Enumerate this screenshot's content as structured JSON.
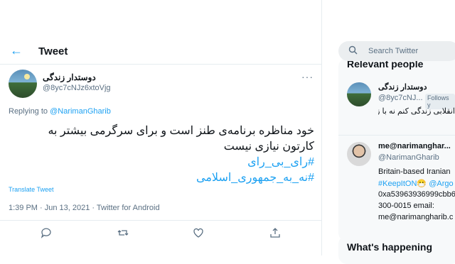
{
  "header": {
    "title": "Tweet"
  },
  "tweet": {
    "author_name": "دوستدار زندگی",
    "author_handle": "@8yc7cNJz6xtoVjg",
    "replying_prefix": "Replying to ",
    "replying_to": "@NarimanGharib",
    "text_line1": "خود مناظره برنامه‌ی طنز است و برای سرگرمی بیشتر به",
    "text_line2": "کارتون نیازی نیست",
    "hashtag1": "#رای_بی_رای",
    "hashtag2": "#نه_به_جمهوری_اسلامی",
    "translate": "Translate Tweet",
    "meta": "1:39 PM · Jun 13, 2021 · Twitter for Android"
  },
  "actions": [
    "reply-icon",
    "retweet-icon",
    "like-icon",
    "share-icon"
  ],
  "sidebar": {
    "search_placeholder": "Search Twitter",
    "relevant_title": "Relevant people",
    "people": [
      {
        "name": "دوستدار زندگی",
        "handle": "@8yc7cNJ...",
        "follows_badge": "Follows y",
        "bio": "انقلابی زندگی کنم نه با زور و"
      },
      {
        "name": "me@narimanghar...",
        "handle": "@NarimanGharib",
        "bio_line1": "Britain-based Iranian",
        "bio_line2_tag1": "#KeepItON",
        "bio_line2_emoji": "😷",
        "bio_line2_tag2": "@Argo",
        "bio_line3": "0xa53963936999cbb6",
        "bio_line4": "300-0015 email:",
        "bio_line5": "me@narimangharib.c"
      }
    ],
    "whats_happening": "What's happening"
  },
  "colors": {
    "accent": "#1da1f2",
    "secondary_text": "#5b7083",
    "border": "#e6ecf0"
  }
}
